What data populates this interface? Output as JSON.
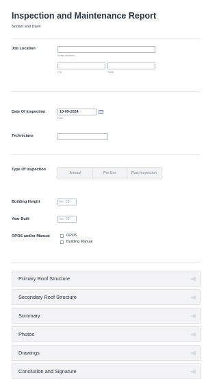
{
  "header": {
    "title": "Inspection and Maintenance Report",
    "subtitle": "Socket and Davit"
  },
  "job_location": {
    "label": "Job Location",
    "street_sublabel": "Street Address",
    "city_sublabel": "City",
    "state_sublabel": "State",
    "street_value": "",
    "city_value": "",
    "state_value": ""
  },
  "date_of_inspection": {
    "label": "Date Of Inspection",
    "value": "10-09-2024",
    "sublabel": "Date",
    "icon": "calendar-icon"
  },
  "technicians": {
    "label": "Technicians",
    "value": ""
  },
  "type_of_inspection": {
    "label": "Type Of Inspection",
    "options": [
      "Annual",
      "Pre-Use",
      "Post Inspection"
    ]
  },
  "building_height": {
    "label": "Building Height",
    "placeholder": "ex: 23"
  },
  "year_built": {
    "label": "Year Built",
    "placeholder": "ex: 23"
  },
  "opos_manual": {
    "label": "OPOS and/or Manual",
    "options": [
      "OPOS",
      "Building Manual"
    ]
  },
  "sections": [
    "Primary Roof Structure",
    "Secondary Roof Structure",
    "Summary",
    "Photos",
    "Drawings",
    "Conclusion and Signature"
  ],
  "colors": {
    "text": "#2c3345",
    "input_border": "#b8bdc9",
    "section_bg": "#f3f3f5",
    "divider": "#e6e6e6"
  }
}
